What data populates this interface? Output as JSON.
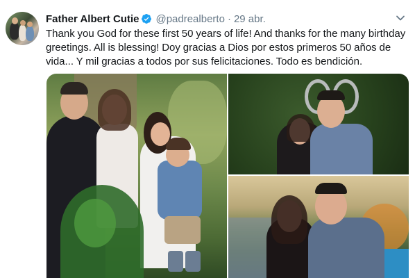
{
  "tweet": {
    "author_name": "Father Albert Cutie",
    "handle": "@padrealberto",
    "separator": "·",
    "date": "29 abr.",
    "text": "Thank you God for these first 50 years of life! And thanks for the many birthday greetings. All is blessing! Doy gracias a Dios por estos primeros 50 años de vida... Y mil gracias a todos por sus felicitaciones. Todo es bendición."
  },
  "icons": {
    "verified": "verified-badge-icon",
    "menu": "chevron-down-icon"
  },
  "colors": {
    "name": "#14171a",
    "secondary": "#657786",
    "verified": "#1da1f2"
  }
}
